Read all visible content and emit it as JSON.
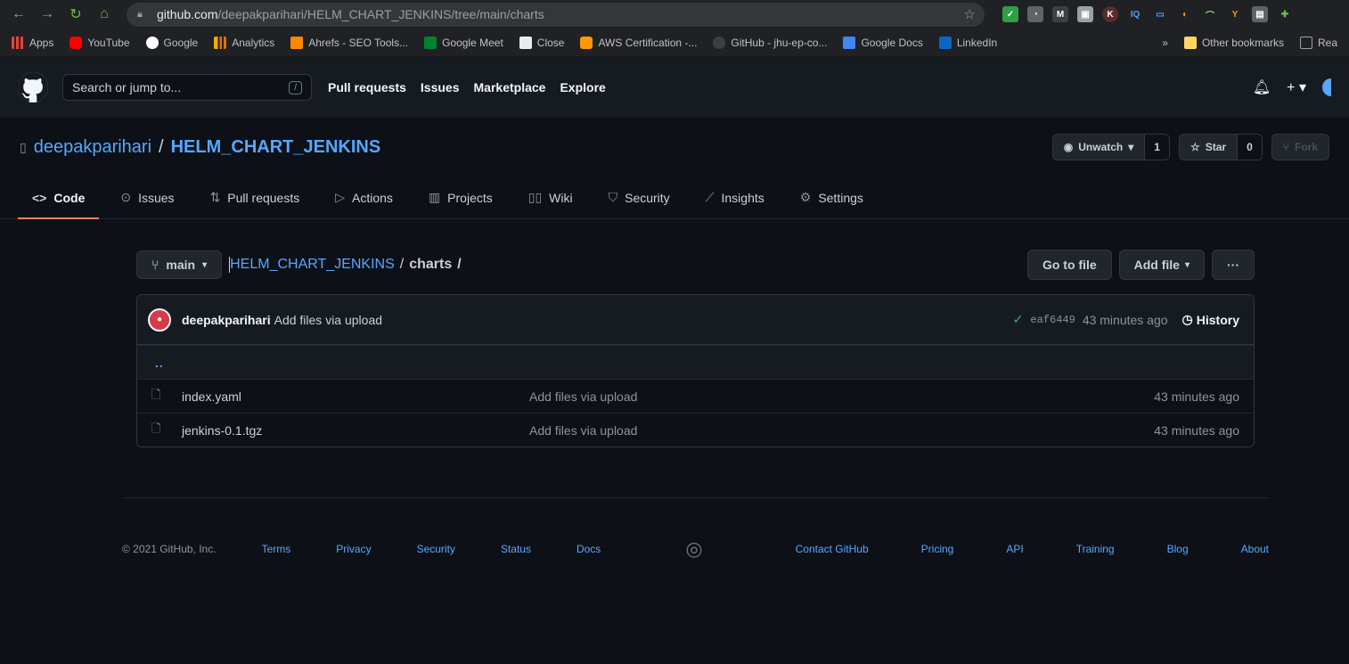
{
  "browser": {
    "url_host": "github.com",
    "url_path": "/deepakparihari/HELM_CHART_JENKINS/tree/main/charts",
    "bookmarks": [
      "Apps",
      "YouTube",
      "Google",
      "Analytics",
      "Ahrefs - SEO Tools...",
      "Google Meet",
      "Close",
      "AWS Certification -...",
      "GitHub - jhu-ep-co...",
      "Google Docs",
      "LinkedIn"
    ],
    "bookmark_overflow": "»",
    "other_bookmarks": "Other bookmarks",
    "reading_list": "Rea"
  },
  "header": {
    "search_placeholder": "Search or jump to...",
    "search_key": "/",
    "nav": [
      "Pull requests",
      "Issues",
      "Marketplace",
      "Explore"
    ]
  },
  "repo": {
    "owner": "deepakparihari",
    "separator": "/",
    "name": "HELM_CHART_JENKINS",
    "watch_label": "Unwatch",
    "watch_count": "1",
    "star_label": "Star",
    "star_count": "0",
    "fork_label": "Fork"
  },
  "tabs": [
    "Code",
    "Issues",
    "Pull requests",
    "Actions",
    "Projects",
    "Wiki",
    "Security",
    "Insights",
    "Settings"
  ],
  "file_nav": {
    "branch": "main",
    "crumb_root": "HELM_CHART_JENKINS",
    "crumb_sep": "/",
    "crumb_current": "charts",
    "crumb_trailing": "/",
    "go_to_file": "Go to file",
    "add_file": "Add file",
    "more": "···"
  },
  "commit": {
    "author": "deepakparihari",
    "message": "Add files via upload",
    "sha": "eaf6449",
    "age": "43 minutes ago",
    "history": "History"
  },
  "files": {
    "up": "..",
    "rows": [
      {
        "name": "index.yaml",
        "message": "Add files via upload",
        "age": "43 minutes ago"
      },
      {
        "name": "jenkins-0.1.tgz",
        "message": "Add files via upload",
        "age": "43 minutes ago"
      }
    ]
  },
  "footer": {
    "copyright": "© 2021 GitHub, Inc.",
    "left_links": [
      "Terms",
      "Privacy",
      "Security",
      "Status",
      "Docs"
    ],
    "right_links": [
      "Contact GitHub",
      "Pricing",
      "API",
      "Training",
      "Blog",
      "About"
    ]
  },
  "colors": {
    "background": "#0d1117",
    "header": "#161b22",
    "link": "#58a6ff",
    "tab_underline": "#f78166",
    "success": "#3fb950"
  }
}
